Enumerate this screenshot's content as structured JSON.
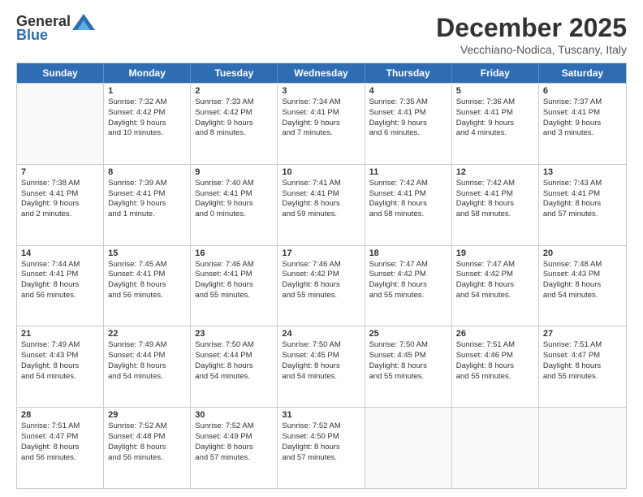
{
  "logo": {
    "text1": "General",
    "text2": "Blue"
  },
  "title": "December 2025",
  "subtitle": "Vecchiano-Nodica, Tuscany, Italy",
  "headers": [
    "Sunday",
    "Monday",
    "Tuesday",
    "Wednesday",
    "Thursday",
    "Friday",
    "Saturday"
  ],
  "rows": [
    [
      {
        "day": "",
        "sunrise": "",
        "sunset": "",
        "daylight": ""
      },
      {
        "day": "1",
        "sunrise": "Sunrise: 7:32 AM",
        "sunset": "Sunset: 4:42 PM",
        "daylight": "Daylight: 9 hours and 10 minutes."
      },
      {
        "day": "2",
        "sunrise": "Sunrise: 7:33 AM",
        "sunset": "Sunset: 4:42 PM",
        "daylight": "Daylight: 9 hours and 8 minutes."
      },
      {
        "day": "3",
        "sunrise": "Sunrise: 7:34 AM",
        "sunset": "Sunset: 4:41 PM",
        "daylight": "Daylight: 9 hours and 7 minutes."
      },
      {
        "day": "4",
        "sunrise": "Sunrise: 7:35 AM",
        "sunset": "Sunset: 4:41 PM",
        "daylight": "Daylight: 9 hours and 6 minutes."
      },
      {
        "day": "5",
        "sunrise": "Sunrise: 7:36 AM",
        "sunset": "Sunset: 4:41 PM",
        "daylight": "Daylight: 9 hours and 4 minutes."
      },
      {
        "day": "6",
        "sunrise": "Sunrise: 7:37 AM",
        "sunset": "Sunset: 4:41 PM",
        "daylight": "Daylight: 9 hours and 3 minutes."
      }
    ],
    [
      {
        "day": "7",
        "sunrise": "Sunrise: 7:38 AM",
        "sunset": "Sunset: 4:41 PM",
        "daylight": "Daylight: 9 hours and 2 minutes."
      },
      {
        "day": "8",
        "sunrise": "Sunrise: 7:39 AM",
        "sunset": "Sunset: 4:41 PM",
        "daylight": "Daylight: 9 hours and 1 minute."
      },
      {
        "day": "9",
        "sunrise": "Sunrise: 7:40 AM",
        "sunset": "Sunset: 4:41 PM",
        "daylight": "Daylight: 9 hours and 0 minutes."
      },
      {
        "day": "10",
        "sunrise": "Sunrise: 7:41 AM",
        "sunset": "Sunset: 4:41 PM",
        "daylight": "Daylight: 8 hours and 59 minutes."
      },
      {
        "day": "11",
        "sunrise": "Sunrise: 7:42 AM",
        "sunset": "Sunset: 4:41 PM",
        "daylight": "Daylight: 8 hours and 58 minutes."
      },
      {
        "day": "12",
        "sunrise": "Sunrise: 7:42 AM",
        "sunset": "Sunset: 4:41 PM",
        "daylight": "Daylight: 8 hours and 58 minutes."
      },
      {
        "day": "13",
        "sunrise": "Sunrise: 7:43 AM",
        "sunset": "Sunset: 4:41 PM",
        "daylight": "Daylight: 8 hours and 57 minutes."
      }
    ],
    [
      {
        "day": "14",
        "sunrise": "Sunrise: 7:44 AM",
        "sunset": "Sunset: 4:41 PM",
        "daylight": "Daylight: 8 hours and 56 minutes."
      },
      {
        "day": "15",
        "sunrise": "Sunrise: 7:45 AM",
        "sunset": "Sunset: 4:41 PM",
        "daylight": "Daylight: 8 hours and 56 minutes."
      },
      {
        "day": "16",
        "sunrise": "Sunrise: 7:46 AM",
        "sunset": "Sunset: 4:41 PM",
        "daylight": "Daylight: 8 hours and 55 minutes."
      },
      {
        "day": "17",
        "sunrise": "Sunrise: 7:46 AM",
        "sunset": "Sunset: 4:42 PM",
        "daylight": "Daylight: 8 hours and 55 minutes."
      },
      {
        "day": "18",
        "sunrise": "Sunrise: 7:47 AM",
        "sunset": "Sunset: 4:42 PM",
        "daylight": "Daylight: 8 hours and 55 minutes."
      },
      {
        "day": "19",
        "sunrise": "Sunrise: 7:47 AM",
        "sunset": "Sunset: 4:42 PM",
        "daylight": "Daylight: 8 hours and 54 minutes."
      },
      {
        "day": "20",
        "sunrise": "Sunrise: 7:48 AM",
        "sunset": "Sunset: 4:43 PM",
        "daylight": "Daylight: 8 hours and 54 minutes."
      }
    ],
    [
      {
        "day": "21",
        "sunrise": "Sunrise: 7:49 AM",
        "sunset": "Sunset: 4:43 PM",
        "daylight": "Daylight: 8 hours and 54 minutes."
      },
      {
        "day": "22",
        "sunrise": "Sunrise: 7:49 AM",
        "sunset": "Sunset: 4:44 PM",
        "daylight": "Daylight: 8 hours and 54 minutes."
      },
      {
        "day": "23",
        "sunrise": "Sunrise: 7:50 AM",
        "sunset": "Sunset: 4:44 PM",
        "daylight": "Daylight: 8 hours and 54 minutes."
      },
      {
        "day": "24",
        "sunrise": "Sunrise: 7:50 AM",
        "sunset": "Sunset: 4:45 PM",
        "daylight": "Daylight: 8 hours and 54 minutes."
      },
      {
        "day": "25",
        "sunrise": "Sunrise: 7:50 AM",
        "sunset": "Sunset: 4:45 PM",
        "daylight": "Daylight: 8 hours and 55 minutes."
      },
      {
        "day": "26",
        "sunrise": "Sunrise: 7:51 AM",
        "sunset": "Sunset: 4:46 PM",
        "daylight": "Daylight: 8 hours and 55 minutes."
      },
      {
        "day": "27",
        "sunrise": "Sunrise: 7:51 AM",
        "sunset": "Sunset: 4:47 PM",
        "daylight": "Daylight: 8 hours and 55 minutes."
      }
    ],
    [
      {
        "day": "28",
        "sunrise": "Sunrise: 7:51 AM",
        "sunset": "Sunset: 4:47 PM",
        "daylight": "Daylight: 8 hours and 56 minutes."
      },
      {
        "day": "29",
        "sunrise": "Sunrise: 7:52 AM",
        "sunset": "Sunset: 4:48 PM",
        "daylight": "Daylight: 8 hours and 56 minutes."
      },
      {
        "day": "30",
        "sunrise": "Sunrise: 7:52 AM",
        "sunset": "Sunset: 4:49 PM",
        "daylight": "Daylight: 8 hours and 57 minutes."
      },
      {
        "day": "31",
        "sunrise": "Sunrise: 7:52 AM",
        "sunset": "Sunset: 4:50 PM",
        "daylight": "Daylight: 8 hours and 57 minutes."
      },
      {
        "day": "",
        "sunrise": "",
        "sunset": "",
        "daylight": ""
      },
      {
        "day": "",
        "sunrise": "",
        "sunset": "",
        "daylight": ""
      },
      {
        "day": "",
        "sunrise": "",
        "sunset": "",
        "daylight": ""
      }
    ]
  ]
}
